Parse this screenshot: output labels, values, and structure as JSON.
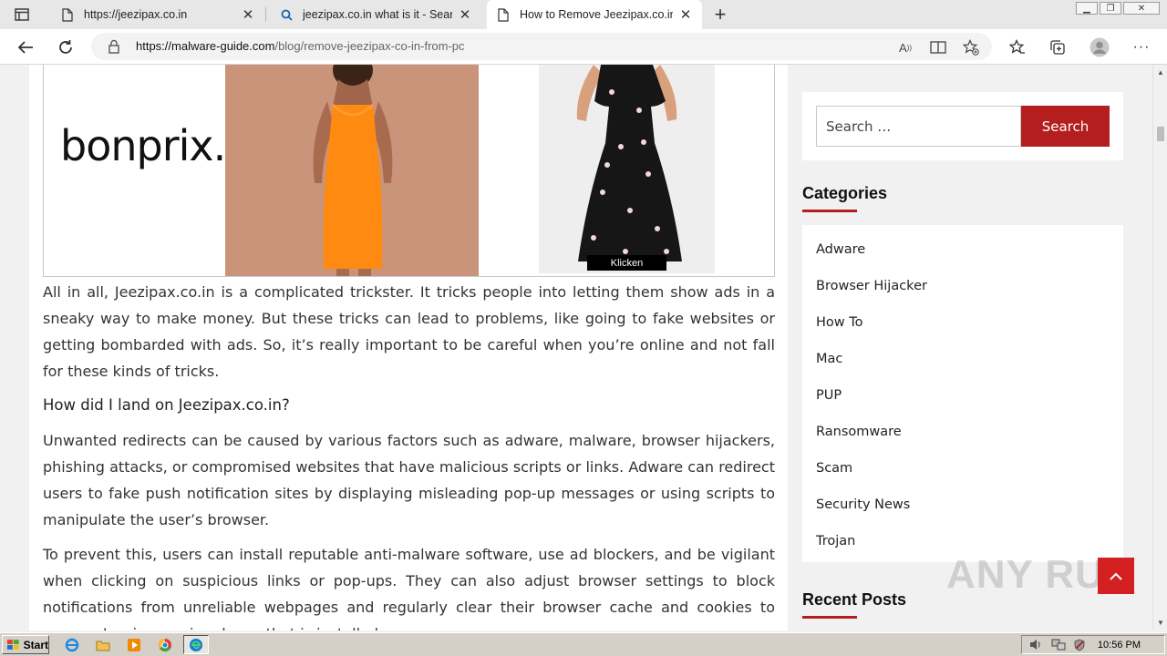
{
  "browser": {
    "tabs": [
      {
        "title": "https://jeezipax.co.in",
        "icon": "page-icon"
      },
      {
        "title": "jeezipax.co.in what is it - Search",
        "icon": "search-icon"
      },
      {
        "title": "How to Remove Jeezipax.co.in f",
        "icon": "page-icon"
      }
    ],
    "url_domain": "https://malware-guide.com",
    "url_path": "/blog/remove-jeezipax-co-in-from-pc"
  },
  "ad": {
    "brand": "bonprix.",
    "cta": "Klicken"
  },
  "article": {
    "p1": "All in all, Jeezipax.co.in is a complicated trickster. It tricks people into letting them show ads in a sneaky way to make money. But these tricks can lead to problems, like going to fake websites or getting bombarded with ads. So, it’s really important to be careful when you’re online and not fall for these kinds of tricks.",
    "h2": "How did I land on Jeezipax.co.in?",
    "p2": "Unwanted redirects can be caused by various factors such as adware, malware, browser hijackers, phishing attacks, or compromised websites that have malicious scripts or links. Adware can redirect users to fake push notification sites by displaying misleading pop-up messages or using scripts to manipulate the user’s browser.",
    "p3": "To prevent this, users can install reputable anti-malware software, use ad blockers, and be vigilant when clicking on suspicious links or pop-ups. They can also adjust browser settings to block notifications from unreliable webpages and regularly clear their browser cache and cookies to remove Jeezipax.co.in adware that is installed."
  },
  "sidebar": {
    "search_placeholder": "Search …",
    "search_button": "Search",
    "categories_title": "Categories",
    "categories": [
      "Adware",
      "Browser Hijacker",
      "How To",
      "Mac",
      "PUP",
      "Ransomware",
      "Scam",
      "Security News",
      "Trojan"
    ],
    "recent_title": "Recent Posts"
  },
  "watermark": "ANY RUN",
  "taskbar": {
    "start": "Start",
    "clock": "10:56 PM"
  },
  "colors": {
    "accent": "#b51e1e",
    "totop": "#d42020"
  }
}
